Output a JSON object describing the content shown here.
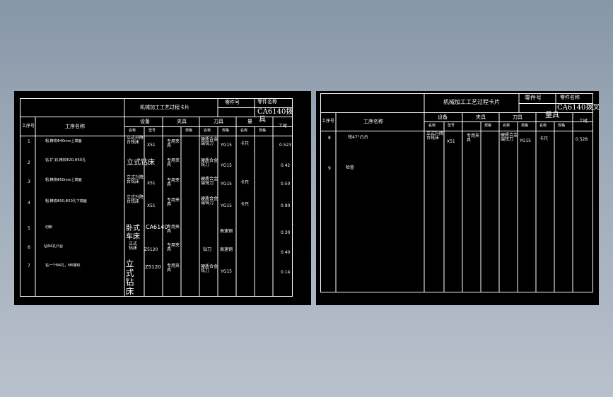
{
  "left_card": {
    "title": "机械加工工艺过程卡片",
    "part_no_label": "零件号",
    "part_name_label": "零件名称",
    "part_name_value": "CA6140拨",
    "headers": {
      "seq": "工序号",
      "op": "工序名称",
      "equip": "设备",
      "fixture": "夹具",
      "tool": "刀具",
      "gauge": "量",
      "gauge_ext": "具",
      "hours": "工时",
      "name": "名称",
      "model": "型号",
      "spec": "规格"
    },
    "rows": [
      {
        "seq": "1",
        "op": "粗,精铣Φ40mm上端面",
        "equip_name": "立式升降台铣床",
        "equip_model": "X51",
        "fixture": "专用夹具",
        "tool": "硬质合金端铣刀",
        "tool_spec": "YG15",
        "gauge": "卡尺",
        "hours": "0.523"
      },
      {
        "seq": "2",
        "op": "钻,扩,铰,精铰Φ20,Φ50孔",
        "equip_name": "立式钻床",
        "equip_model": "",
        "fixture": "专用夹具",
        "tool": "硬质合金铣刀",
        "tool_spec": "YG15",
        "gauge": "",
        "hours": "0.42"
      },
      {
        "seq": "3",
        "op": "粗,精铣Φ50mm上端面",
        "equip_name": "立式升降台铣床",
        "equip_model": "X51",
        "fixture": "专用夹具",
        "tool": "硬质合金端铣刀",
        "tool_spec": "YG15",
        "gauge": "卡尺",
        "hours": "0.50"
      },
      {
        "seq": "4",
        "op": "粗,精铣Φ50,Φ20孔下端面",
        "equip_name": "立式升降台铣床",
        "equip_model": "X51",
        "fixture": "专用夹具",
        "tool": "硬质合金端铣刀",
        "tool_spec": "YG15",
        "gauge": "卡尺",
        "hours": "0.90"
      },
      {
        "seq": "5",
        "op": "切断",
        "equip_name": "卧式车床",
        "equip_model": "CA6140",
        "fixture": "专用夹具",
        "tool": "",
        "tool_spec": "高速钢",
        "gauge": "",
        "hours": "0.30"
      },
      {
        "seq": "6",
        "op": "钻Φ4孔凸台",
        "equip_name": "立式钻床",
        "equip_model": "Z5120",
        "fixture": "专用夹具",
        "tool": "钻刀",
        "tool_spec": "高速钢",
        "gauge": "",
        "hours": "0.40"
      },
      {
        "seq": "7",
        "op": "钻一个Φ4孔，M6螺纹",
        "equip_name": "立式钻床",
        "equip_model": "Z5120",
        "fixture": "专用夹具",
        "tool": "硬质合金铣刀",
        "tool_spec": "YG15",
        "gauge": "",
        "hours": "0.14"
      }
    ]
  },
  "right_card": {
    "title": "机械加工工艺过程卡片",
    "part_no_label": "零件号",
    "part_name_label": "零件名称",
    "part_name_value": "CA6140拨叉",
    "headers": {
      "seq": "工序号",
      "op": "工序名称",
      "equip": "设备",
      "fixture": "夹具",
      "tool": "刀具",
      "gauge": "量具",
      "hours": "工时",
      "name": "名称",
      "model": "型号",
      "spec": "规格"
    },
    "rows": [
      {
        "seq": "8",
        "op": "铣47°凸台",
        "equip_name": "立式升降台铣床",
        "equip_model": "X51",
        "fixture": "专用夹具",
        "tool": "硬质合金端铣刀",
        "tool_spec": "YG15",
        "gauge": "卡尺",
        "hours": "0.528"
      },
      {
        "seq": "9",
        "op": "检查",
        "equip_name": "",
        "equip_model": "",
        "fixture": "",
        "tool": "",
        "tool_spec": "",
        "gauge": "",
        "hours": ""
      }
    ]
  }
}
